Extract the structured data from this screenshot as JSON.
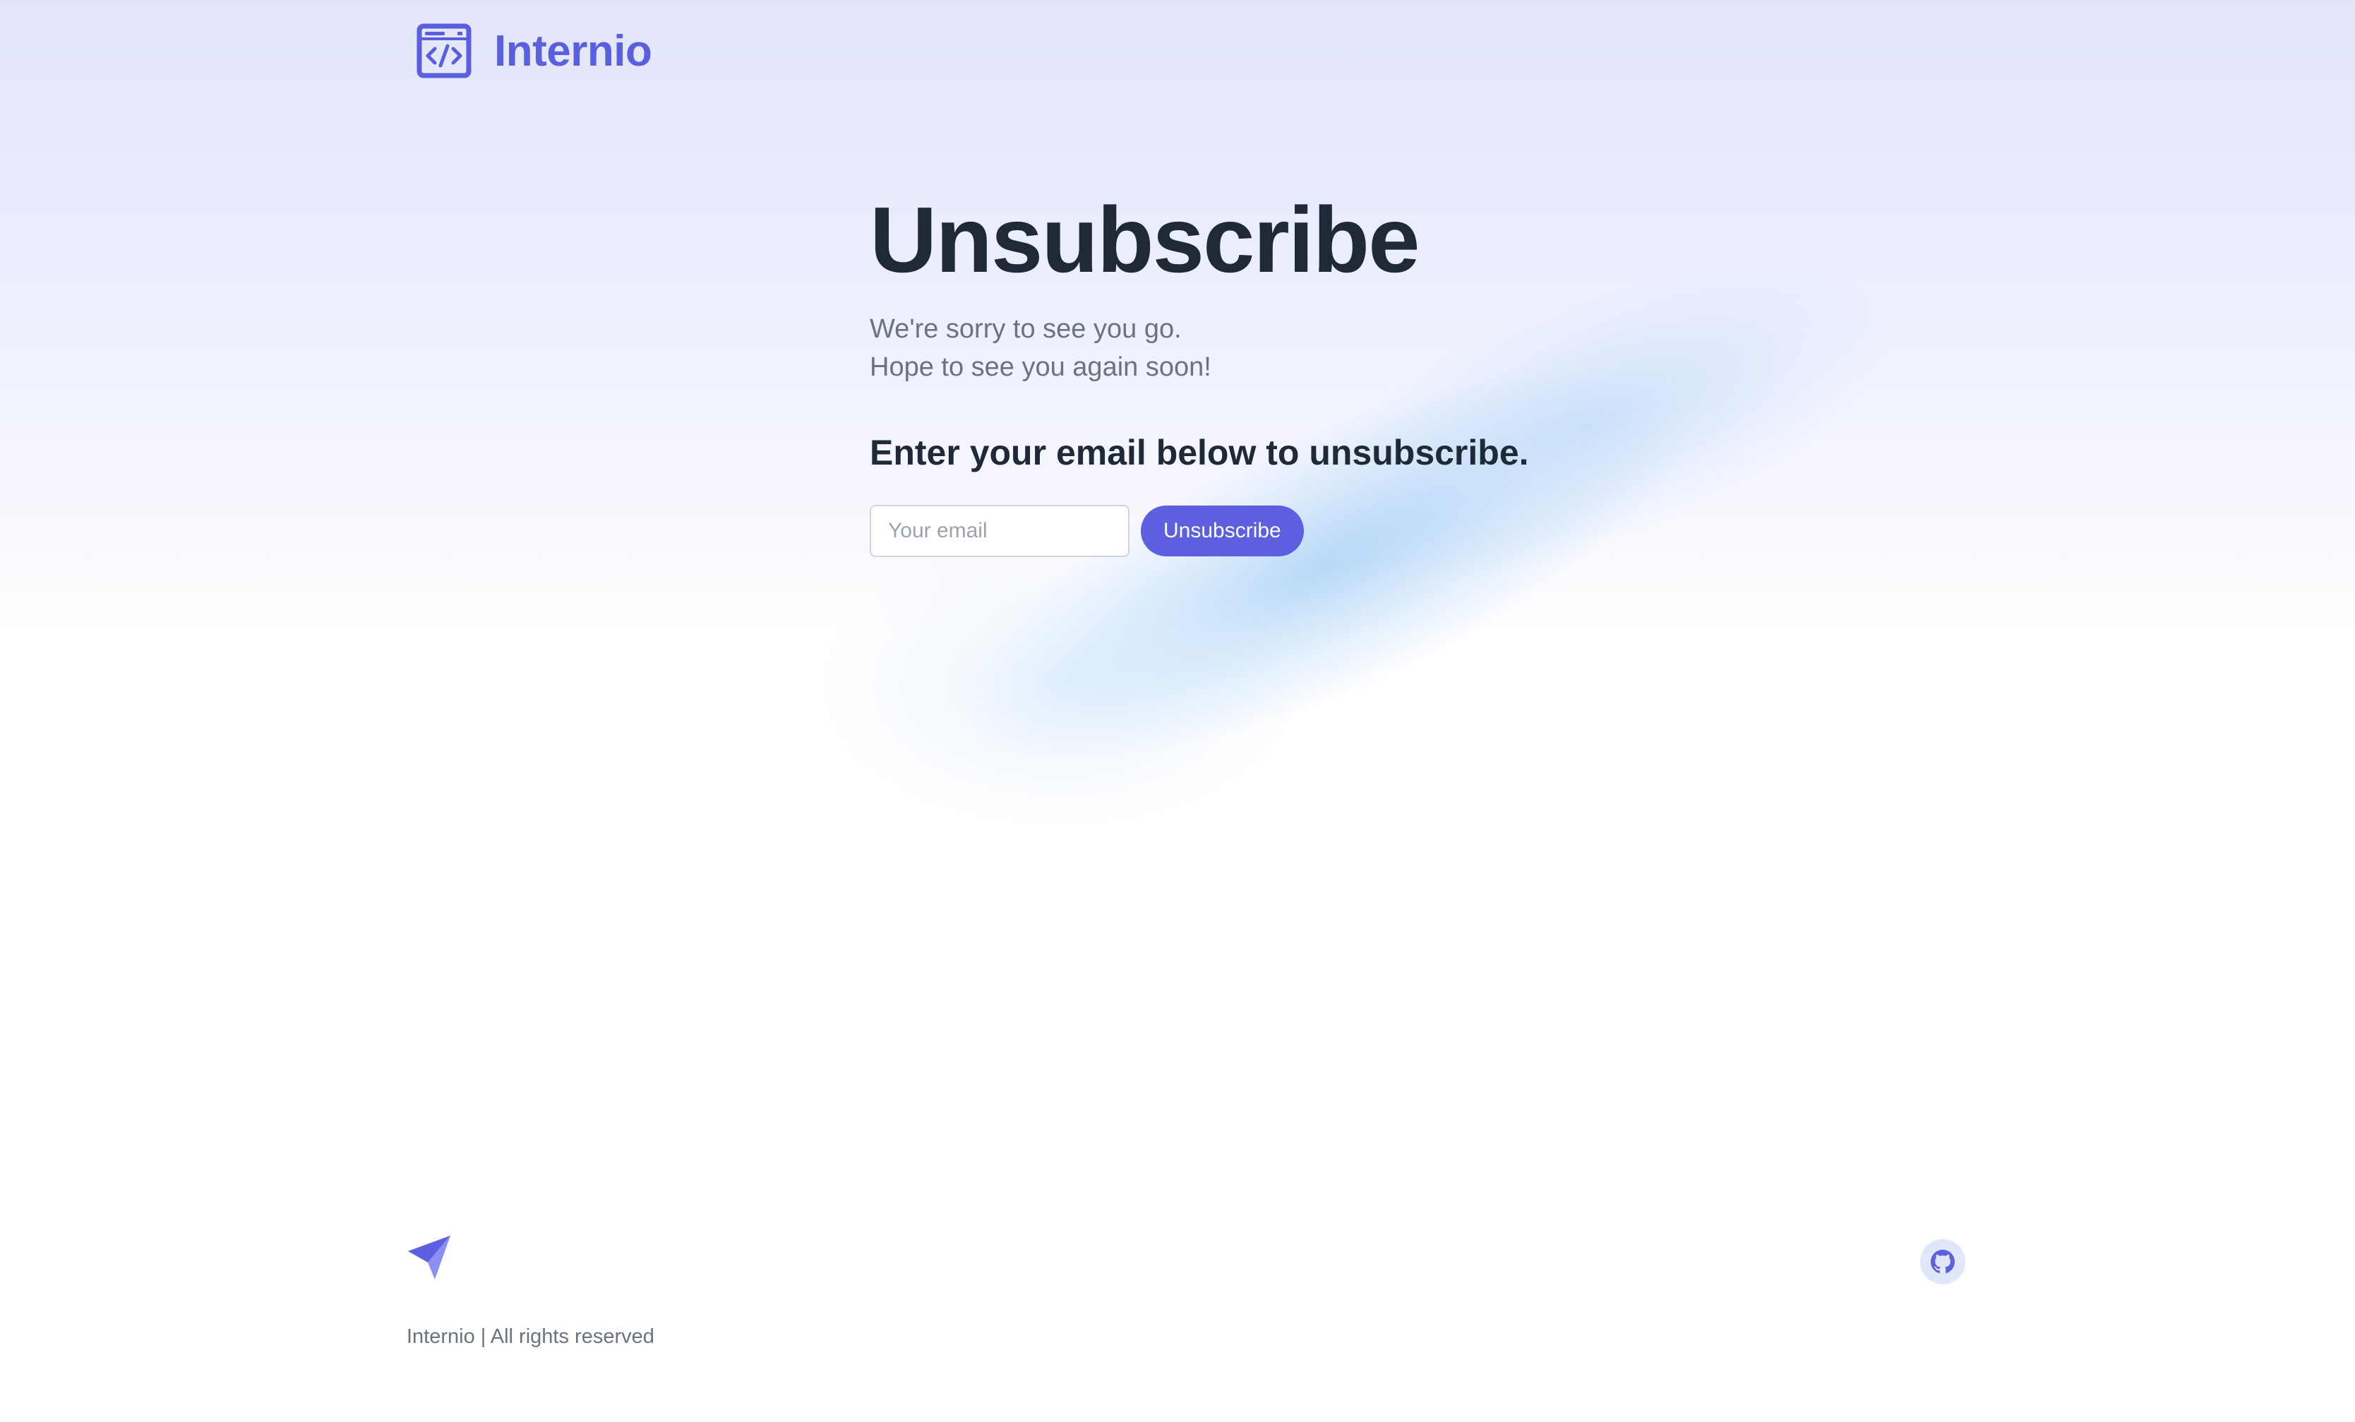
{
  "header": {
    "brand": "Internio",
    "logo_icon": "code-window-icon"
  },
  "main": {
    "title": "Unsubscribe",
    "sub_line_1": "We're sorry to see you go.",
    "sub_line_2": "Hope to see you again soon!",
    "prompt": "Enter your email below to unsubscribe.",
    "email_placeholder": "Your email",
    "email_value": "",
    "button_label": "Unsubscribe"
  },
  "footer": {
    "logo_icon": "paper-plane-icon",
    "social_icon": "github-icon",
    "copyright": "Internio | All rights reserved"
  },
  "colors": {
    "brand": "#5a5fe0",
    "button": "#5b5fe0",
    "heading": "#1f2937",
    "muted": "#6b7280"
  }
}
